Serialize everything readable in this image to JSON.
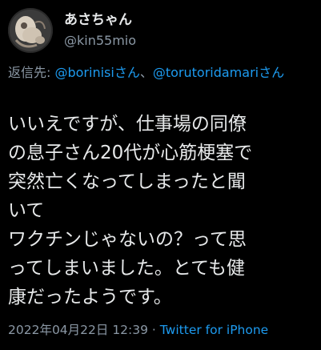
{
  "user": {
    "display_name": "あさちゃん",
    "handle": "@kin55mio"
  },
  "reply": {
    "prefix": "返信先: ",
    "mention1": "@borinisiさん",
    "separator": "、",
    "mention2": "@torutoridamariさん"
  },
  "tweet": {
    "text": "いいえですが、仕事場の同僚\nの息子さん20代が心筋梗塞で\n突然亡くなってしまったと聞\nいて\nワクチンじゃないの？って思\nってしまいました。とても健\n康だったようです。"
  },
  "meta": {
    "timestamp": "2022年04月22日 12:39",
    "dot": " · ",
    "client": "Twitter for iPhone"
  },
  "colors": {
    "background": "#000000",
    "text": "#e7e9ea",
    "secondary": "#8b98a5",
    "link": "#1d9bf0"
  },
  "icons": {
    "avatar": "avatar-image"
  }
}
